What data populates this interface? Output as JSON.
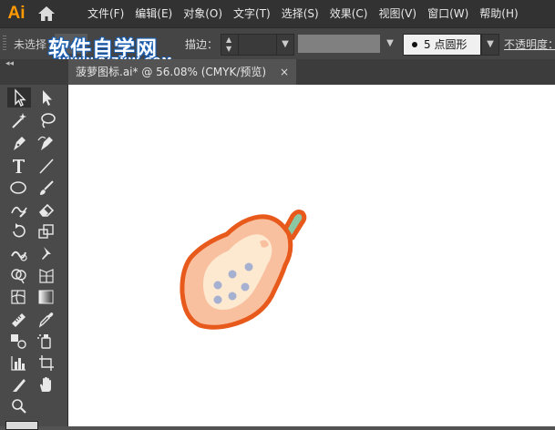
{
  "app": {
    "logo": "Ai"
  },
  "menu": {
    "items": [
      "文件(F)",
      "编辑(E)",
      "对象(O)",
      "文字(T)",
      "选择(S)",
      "效果(C)",
      "视图(V)",
      "窗口(W)",
      "帮助(H)"
    ]
  },
  "control_bar": {
    "selection_status": "未选择",
    "stroke_label": "描边：",
    "brush_value": "5 点圆形",
    "opacity_label": "不透明度："
  },
  "watermark": {
    "title": "软件自学网",
    "url": "WWW.RJZXW.COM"
  },
  "document_tab": {
    "title": "菠萝图标.ai* @ 56.08% (CMYK/预览)",
    "close": "×"
  },
  "tools": [
    "selection-tool",
    "direct-selection-tool",
    "magic-wand-tool",
    "lasso-tool",
    "pen-tool",
    "curvature-tool",
    "type-tool",
    "line-segment-tool",
    "ellipse-tool",
    "paintbrush-tool",
    "shaper-tool",
    "eraser-tool",
    "rotate-tool",
    "scale-tool",
    "warp-tool",
    "puppet-warp-tool",
    "shape-builder-tool",
    "perspective-grid-tool",
    "mesh-tool",
    "gradient-tool",
    "measure-tool",
    "eyedropper-tool",
    "blend-tool",
    "symbol-sprayer-tool",
    "column-graph-tool",
    "artboard-tool",
    "slice-tool",
    "hand-tool",
    "zoom-tool"
  ],
  "colors": {
    "papaya_outline": "#e8591c",
    "papaya_flesh": "#f9c0a0",
    "papaya_inner": "#fde8d0",
    "papaya_seeds": "#a6b0d0",
    "papaya_stem": "#8cc7a3"
  }
}
